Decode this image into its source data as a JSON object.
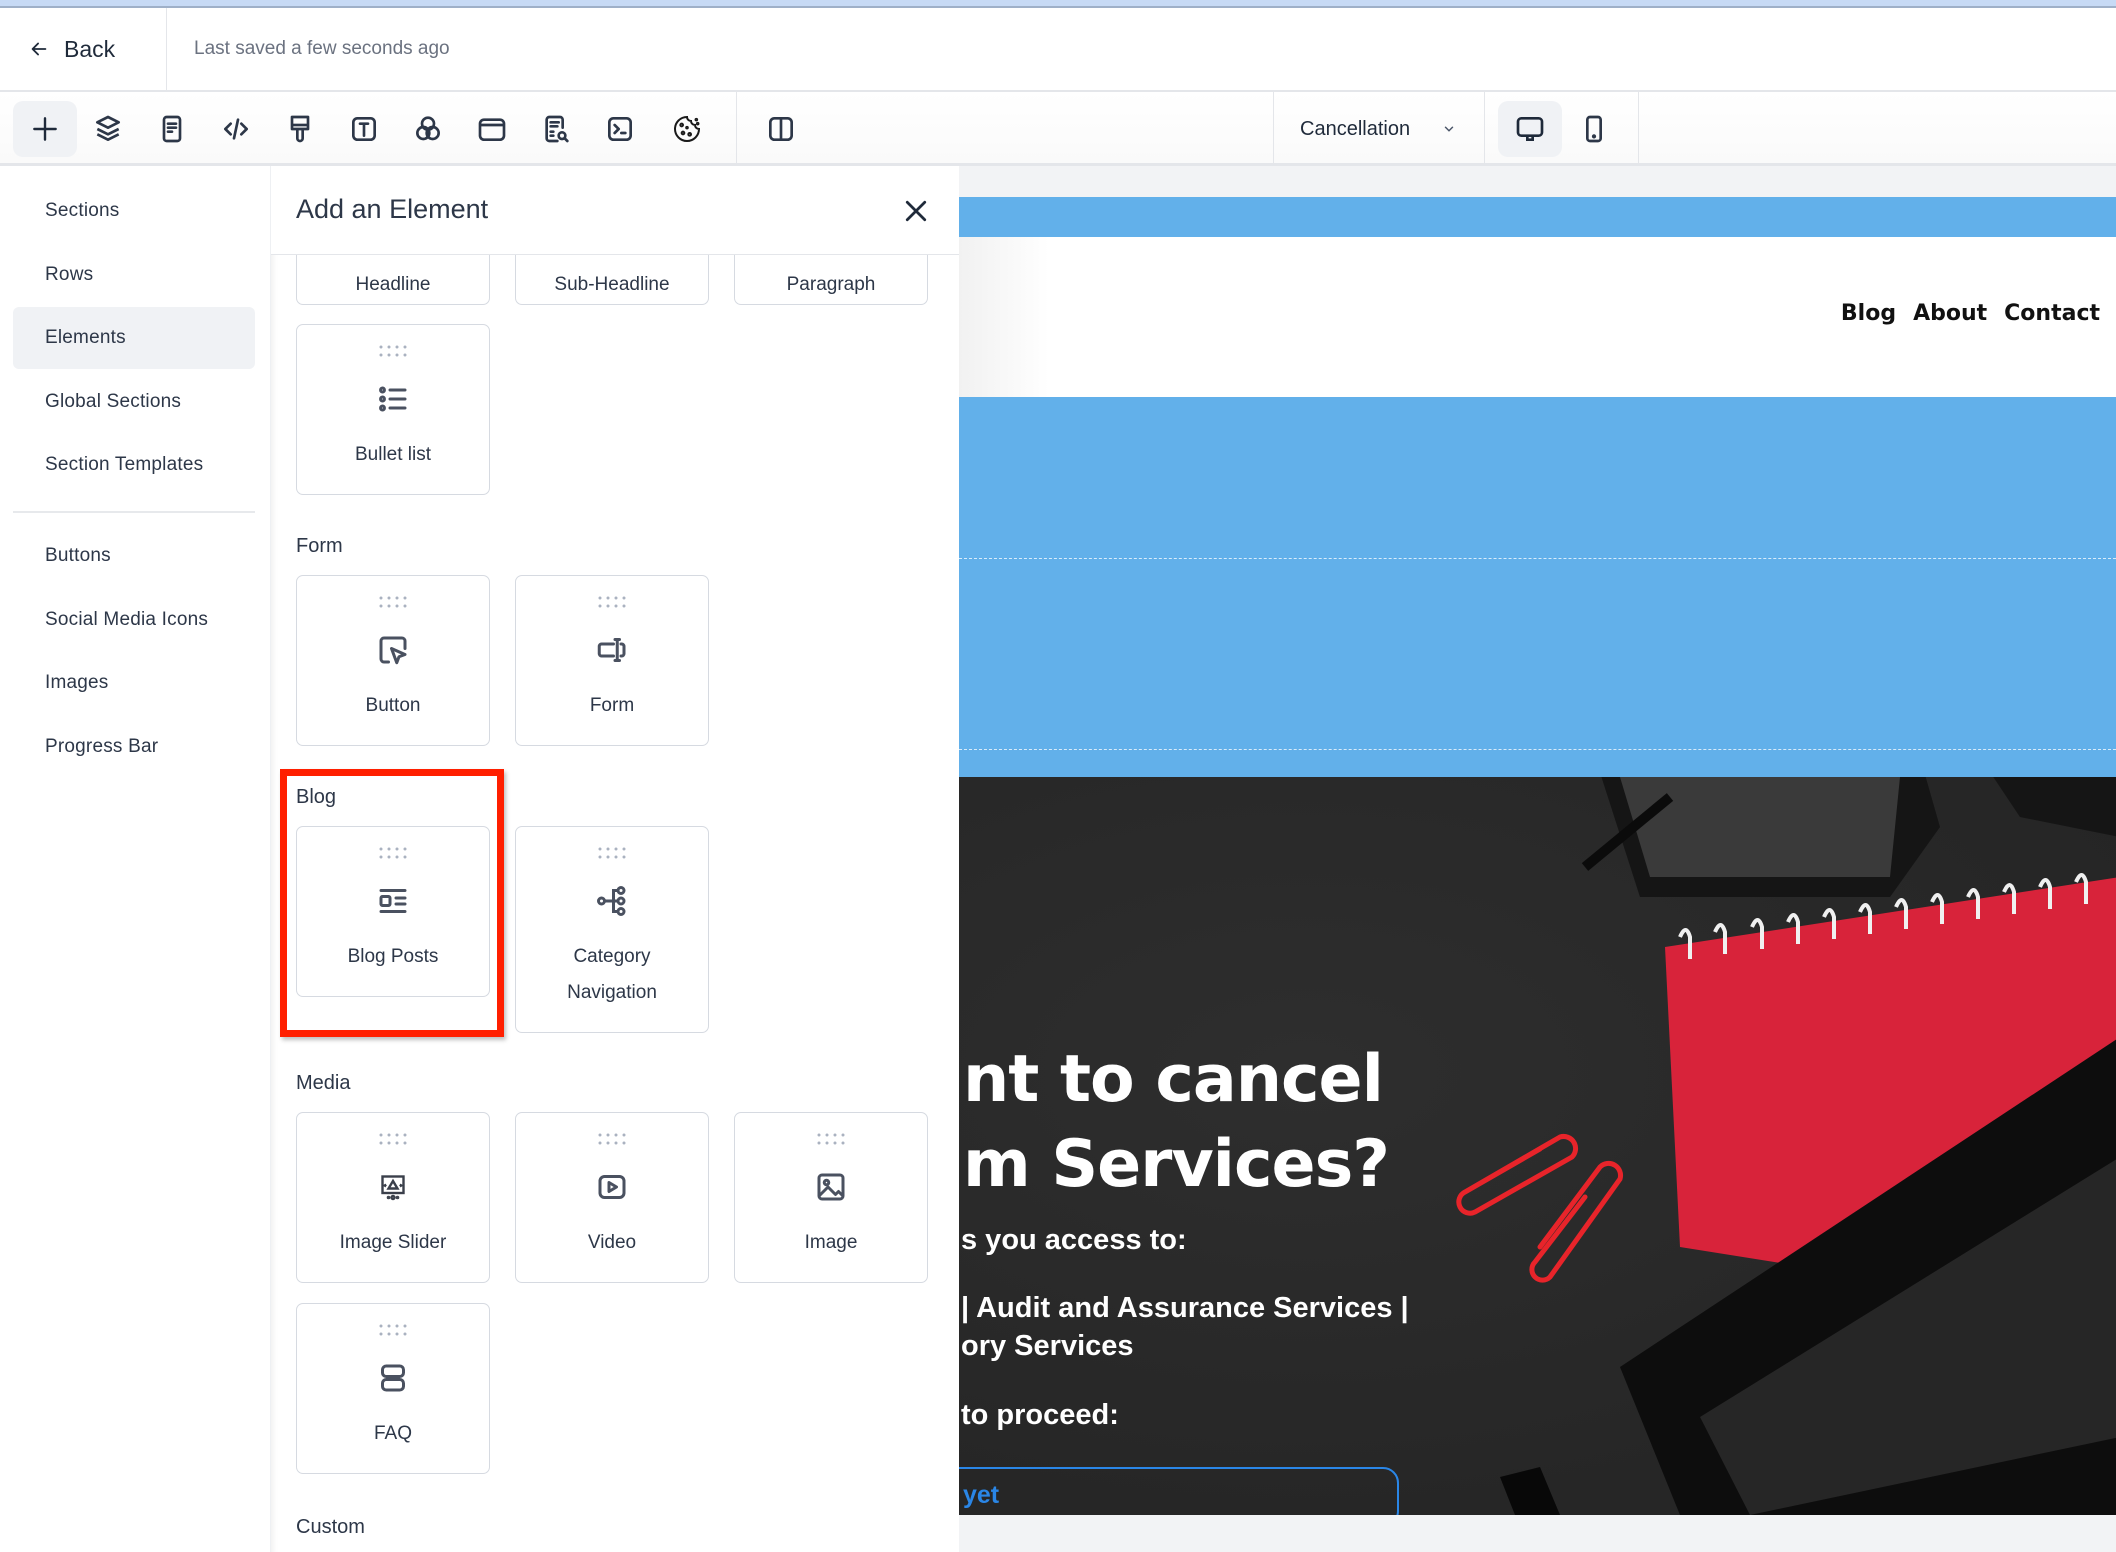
{
  "topbar": {
    "back_label": "Back",
    "saved_status": "Last saved a few seconds ago"
  },
  "toolbar": {
    "icons": [
      "add-icon",
      "layers-icon",
      "page-settings-icon",
      "code-icon",
      "paint-brush-icon",
      "text-icon",
      "color-circles-icon",
      "layout-window-icon",
      "seo-search-icon",
      "terminal-icon",
      "cookie-icon",
      "split-view-icon"
    ],
    "page_select": {
      "value": "Cancellation"
    },
    "devices": [
      "desktop-icon",
      "mobile-icon"
    ],
    "active_device": "desktop"
  },
  "leftnav": {
    "items": [
      {
        "label": "Sections"
      },
      {
        "label": "Rows"
      },
      {
        "label": "Elements",
        "active": true
      },
      {
        "label": "Global Sections"
      },
      {
        "label": "Section Templates"
      },
      {
        "label": "Buttons"
      },
      {
        "label": "Social Media Icons"
      },
      {
        "label": "Images"
      },
      {
        "label": "Progress Bar"
      }
    ]
  },
  "panel": {
    "title": "Add an Element",
    "text_cards": [
      "Headline",
      "Sub-Headline",
      "Paragraph",
      "Bullet list"
    ],
    "sections": {
      "form": {
        "label": "Form",
        "cards": [
          "Button",
          "Form"
        ]
      },
      "blog": {
        "label": "Blog",
        "cards": [
          "Blog Posts",
          "Category",
          "Navigation"
        ]
      },
      "media": {
        "label": "Media",
        "cards": [
          "Image Slider",
          "Video",
          "Image",
          "FAQ"
        ]
      },
      "custom": {
        "label": "Custom"
      }
    },
    "highlight_color": "#ff1f00"
  },
  "canvas": {
    "nav_links": [
      "Blog",
      "About",
      "Contact"
    ],
    "hero": {
      "line1": "nt to cancel",
      "line2": "m Services?",
      "p1": "s you access to:",
      "p2": "| Audit and Assurance Services |",
      "p3": "ory Services",
      "p4": "to proceed:",
      "button_text": "yet"
    },
    "colors": {
      "section_blue": "#62b0ea",
      "button_blue": "#2a86e6"
    }
  }
}
